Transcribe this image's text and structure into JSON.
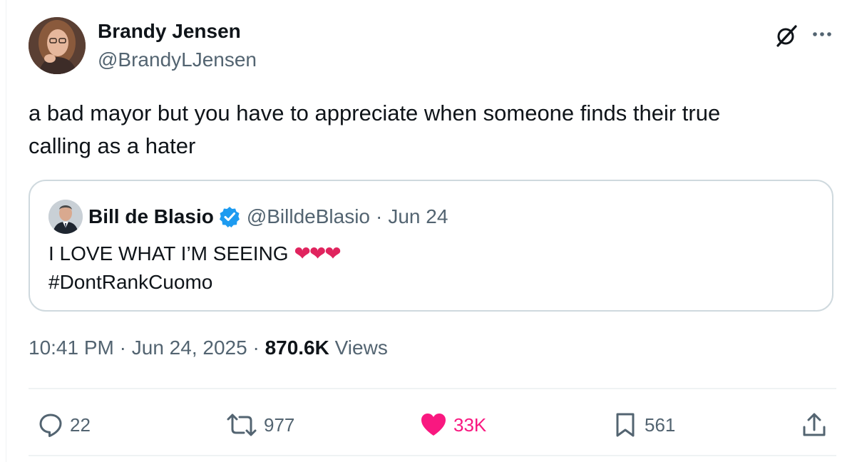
{
  "author": {
    "name": "Brandy Jensen",
    "handle": "@BrandyLJensen"
  },
  "tweet": {
    "line1": "a bad mayor but you have to appreciate when someone finds their true",
    "line2": "calling as a hater"
  },
  "quote": {
    "name": "Bill de Blasio",
    "handle": "@BilldeBlasio",
    "separator": "·",
    "date": "Jun 24",
    "line1": "I LOVE WHAT I’M SEEING",
    "hearts": "❤❤❤",
    "line2": "#DontRankCuomo"
  },
  "meta": {
    "time": "10:41 PM",
    "sep1": " · ",
    "date": "Jun 24, 2025",
    "sep2": " · ",
    "views_count": "870.6K",
    "views_label": " Views"
  },
  "actions": {
    "replies": "22",
    "reposts": "977",
    "likes": "33K",
    "bookmarks": "561"
  },
  "colors": {
    "like_pink": "#f91880",
    "verified_blue": "#1d9bf0",
    "secondary_text": "#536471",
    "border": "#cfd9de"
  }
}
